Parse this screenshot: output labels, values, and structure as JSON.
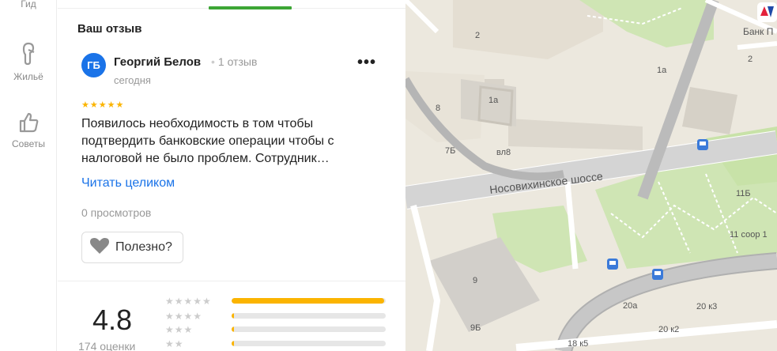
{
  "rail": {
    "items": [
      {
        "label": "Гид",
        "icon": "guide-icon"
      },
      {
        "label": "Жильё",
        "icon": "housing-icon"
      },
      {
        "label": "Советы",
        "icon": "thumbs-up-icon"
      }
    ]
  },
  "panel": {
    "section_title": "Ваш отзыв",
    "review": {
      "avatar_initials": "ГБ",
      "author": "Георгий Белов",
      "author_reviews": "1 отзыв",
      "date": "сегодня",
      "stars": 5,
      "text": "Появилось необходимость в том чтобы подтвердить банковские операции чтобы с налоговой не было проблем. Сотрудник…",
      "read_more": "Читать целиком",
      "views": "0 просмотров",
      "useful_label": "Полезно?"
    },
    "summary": {
      "rating": "4.8",
      "count_label": "174 оценки",
      "distribution": [
        {
          "stars": 5,
          "fraction": 0.99
        },
        {
          "stars": 4,
          "fraction": 0.01
        },
        {
          "stars": 3,
          "fraction": 0.01
        },
        {
          "stars": 2,
          "fraction": 0.01
        }
      ]
    },
    "colors": {
      "accent_green": "#3ca635",
      "link_blue": "#1a73e8",
      "star_yellow": "#fbb400"
    }
  },
  "map": {
    "labels": {
      "street": "Носовихинское шоссе",
      "bank": "Банк П",
      "b2a": "2",
      "b2b": "2",
      "b1a": "1а",
      "b1a2": "1а",
      "b8": "8",
      "b7b": "7Б",
      "vl8": "вл8",
      "b11b": "11Б",
      "b11s1": "11 соор 1",
      "b9": "9",
      "b9b": "9Б",
      "b20a": "20а",
      "b20k3": "20 к3",
      "b20k2": "20 к2",
      "b18k5": "18 к5"
    }
  }
}
